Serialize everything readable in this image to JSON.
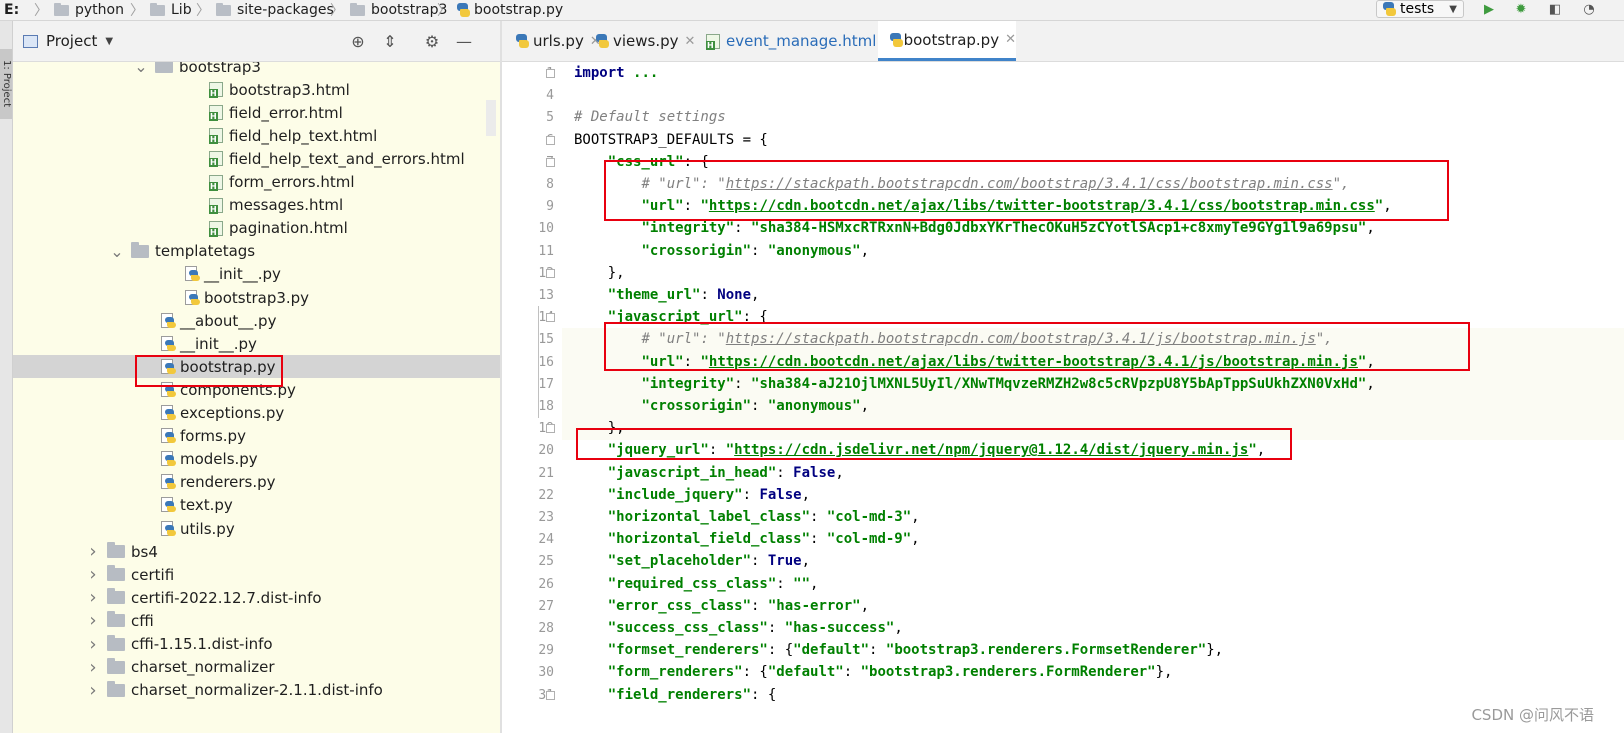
{
  "breadcrumbs": [
    "E:",
    "python",
    "Lib",
    "site-packages",
    "bootstrap3",
    "bootstrap.py"
  ],
  "run_config": "tests",
  "toolbar_icons": [
    "run-icon",
    "debug-icon",
    "coverage-icon",
    "profile-icon"
  ],
  "colors": {
    "accent": "#4083c9",
    "highlight_box": "#e8000f",
    "tree_bg": "#fdfde8",
    "keyword": "#000080",
    "string": "#008000"
  },
  "project_panel": {
    "title": "Project",
    "strip_label": "1: Project",
    "tree": [
      {
        "label": "bootstrap3",
        "kind": "folder",
        "expanded": true
      },
      {
        "label": "bootstrap3.html",
        "kind": "html"
      },
      {
        "label": "field_error.html",
        "kind": "html"
      },
      {
        "label": "field_help_text.html",
        "kind": "html"
      },
      {
        "label": "field_help_text_and_errors.html",
        "kind": "html"
      },
      {
        "label": "form_errors.html",
        "kind": "html"
      },
      {
        "label": "messages.html",
        "kind": "html"
      },
      {
        "label": "pagination.html",
        "kind": "html"
      },
      {
        "label": "templatetags",
        "kind": "folder",
        "expanded": true
      },
      {
        "label": "__init__.py",
        "kind": "py"
      },
      {
        "label": "bootstrap3.py",
        "kind": "py"
      },
      {
        "label": "__about__.py",
        "kind": "py"
      },
      {
        "label": "__init__.py",
        "kind": "py"
      },
      {
        "label": "bootstrap.py",
        "kind": "py",
        "selected": true
      },
      {
        "label": "components.py",
        "kind": "py"
      },
      {
        "label": "exceptions.py",
        "kind": "py"
      },
      {
        "label": "forms.py",
        "kind": "py"
      },
      {
        "label": "models.py",
        "kind": "py"
      },
      {
        "label": "renderers.py",
        "kind": "py"
      },
      {
        "label": "text.py",
        "kind": "py"
      },
      {
        "label": "utils.py",
        "kind": "py"
      },
      {
        "label": "bs4",
        "kind": "folder",
        "expanded": false
      },
      {
        "label": "certifi",
        "kind": "folder",
        "expanded": false
      },
      {
        "label": "certifi-2022.12.7.dist-info",
        "kind": "folder",
        "expanded": false
      },
      {
        "label": "cffi",
        "kind": "folder",
        "expanded": false
      },
      {
        "label": "cffi-1.15.1.dist-info",
        "kind": "folder",
        "expanded": false
      },
      {
        "label": "charset_normalizer",
        "kind": "folder",
        "expanded": false
      },
      {
        "label": "charset_normalizer-2.1.1.dist-info",
        "kind": "folder",
        "expanded": false
      }
    ]
  },
  "editor_tabs": [
    {
      "label": "urls.py",
      "kind": "py"
    },
    {
      "label": "views.py",
      "kind": "py"
    },
    {
      "label": "event_manage.html",
      "kind": "html"
    },
    {
      "label": "bootstrap.py",
      "kind": "py",
      "active": true
    }
  ],
  "code_lines": [
    {
      "n": "1",
      "parts": [
        [
          "k",
          "import"
        ],
        [
          "",
          " "
        ],
        [
          "s",
          "..."
        ]
      ]
    },
    {
      "n": "4",
      "parts": []
    },
    {
      "n": "5",
      "parts": [
        [
          "cm",
          "# Default settings"
        ]
      ]
    },
    {
      "n": "6",
      "parts": [
        [
          "",
          "BOOTSTRAP3_DEFAULTS = {"
        ]
      ]
    },
    {
      "n": "7",
      "parts": [
        [
          "",
          "    "
        ],
        [
          "s",
          "\"css_url\""
        ],
        [
          "",
          ": {"
        ]
      ]
    },
    {
      "n": "8",
      "parts": [
        [
          "",
          "        "
        ],
        [
          "cm",
          "# \"url\": \""
        ],
        [
          "cm u",
          "https://stackpath.bootstrapcdn.com/bootstrap/3.4.1/css/bootstrap.min.css"
        ],
        [
          "cm",
          "\","
        ]
      ]
    },
    {
      "n": "9",
      "parts": [
        [
          "",
          "        "
        ],
        [
          "s",
          "\"url\""
        ],
        [
          "",
          ": "
        ],
        [
          "s",
          "\""
        ],
        [
          "s u",
          "https://cdn.bootcdn.net/ajax/libs/twitter-bootstrap/3.4.1/css/bootstrap.min.css"
        ],
        [
          "s",
          "\""
        ],
        [
          "",
          ","
        ]
      ]
    },
    {
      "n": "10",
      "parts": [
        [
          "",
          "        "
        ],
        [
          "s",
          "\"integrity\""
        ],
        [
          "",
          ": "
        ],
        [
          "s",
          "\"sha384-HSMxcRTRxnN+Bdg0JdbxYKrThecOKuH5zCYotlSAcp1+c8xmyTe9GYg1l9a69psu\""
        ],
        [
          "",
          ","
        ]
      ]
    },
    {
      "n": "11",
      "parts": [
        [
          "",
          "        "
        ],
        [
          "s",
          "\"crossorigin\""
        ],
        [
          "",
          ": "
        ],
        [
          "s",
          "\"anonymous\""
        ],
        [
          "",
          ","
        ]
      ]
    },
    {
      "n": "12",
      "parts": [
        [
          "",
          "    },"
        ]
      ]
    },
    {
      "n": "13",
      "parts": [
        [
          "",
          "    "
        ],
        [
          "s",
          "\"theme_url\""
        ],
        [
          "",
          ": "
        ],
        [
          "k",
          "None"
        ],
        [
          "",
          ","
        ]
      ]
    },
    {
      "n": "14",
      "parts": [
        [
          "",
          "    "
        ],
        [
          "s",
          "\"javascript_url\""
        ],
        [
          "",
          ": {"
        ]
      ]
    },
    {
      "n": "15",
      "parts": [
        [
          "",
          "        "
        ],
        [
          "cm",
          "# \"url\": \""
        ],
        [
          "cm u",
          "https://stackpath.bootstrapcdn.com/bootstrap/3.4.1/js/bootstrap.min.js"
        ],
        [
          "cm",
          "\","
        ]
      ]
    },
    {
      "n": "16",
      "parts": [
        [
          "",
          "        "
        ],
        [
          "s",
          "\"url\""
        ],
        [
          "",
          ": "
        ],
        [
          "s",
          "\""
        ],
        [
          "s u",
          "https://cdn.bootcdn.net/ajax/libs/twitter-bootstrap/3.4.1/js/bootstrap.min.js"
        ],
        [
          "s",
          "\""
        ],
        [
          "",
          ","
        ]
      ]
    },
    {
      "n": "17",
      "parts": [
        [
          "",
          "        "
        ],
        [
          "s",
          "\"integrity\""
        ],
        [
          "",
          ": "
        ],
        [
          "s",
          "\"sha384-aJ21OjlMXNL5UyIl/XNwTMqvzeRMZH2w8c5cRVpzpU8Y5bApTppSuUkhZXN0VxHd\""
        ],
        [
          "",
          ","
        ]
      ]
    },
    {
      "n": "18",
      "parts": [
        [
          "",
          "        "
        ],
        [
          "s",
          "\"crossorigin\""
        ],
        [
          "",
          ": "
        ],
        [
          "s",
          "\"anonymous\""
        ],
        [
          "",
          ","
        ]
      ]
    },
    {
      "n": "19",
      "parts": [
        [
          "",
          "    },"
        ]
      ]
    },
    {
      "n": "20",
      "parts": [
        [
          "",
          "    "
        ],
        [
          "s",
          "\"jquery_url\""
        ],
        [
          "",
          ": "
        ],
        [
          "s",
          "\""
        ],
        [
          "s u",
          "https://cdn.jsdelivr.net/npm/jquery@1.12.4/dist/jquery.min.js"
        ],
        [
          "s",
          "\""
        ],
        [
          "",
          ","
        ]
      ]
    },
    {
      "n": "21",
      "parts": [
        [
          "",
          "    "
        ],
        [
          "s",
          "\"javascript_in_head\""
        ],
        [
          "",
          ": "
        ],
        [
          "k",
          "False"
        ],
        [
          "",
          ","
        ]
      ]
    },
    {
      "n": "22",
      "parts": [
        [
          "",
          "    "
        ],
        [
          "s",
          "\"include_jquery\""
        ],
        [
          "",
          ": "
        ],
        [
          "k",
          "False"
        ],
        [
          "",
          ","
        ]
      ]
    },
    {
      "n": "23",
      "parts": [
        [
          "",
          "    "
        ],
        [
          "s",
          "\"horizontal_label_class\""
        ],
        [
          "",
          ": "
        ],
        [
          "s",
          "\"col-md-3\""
        ],
        [
          "",
          ","
        ]
      ]
    },
    {
      "n": "24",
      "parts": [
        [
          "",
          "    "
        ],
        [
          "s",
          "\"horizontal_field_class\""
        ],
        [
          "",
          ": "
        ],
        [
          "s",
          "\"col-md-9\""
        ],
        [
          "",
          ","
        ]
      ]
    },
    {
      "n": "25",
      "parts": [
        [
          "",
          "    "
        ],
        [
          "s",
          "\"set_placeholder\""
        ],
        [
          "",
          ": "
        ],
        [
          "k",
          "True"
        ],
        [
          "",
          ","
        ]
      ]
    },
    {
      "n": "26",
      "parts": [
        [
          "",
          "    "
        ],
        [
          "s",
          "\"required_css_class\""
        ],
        [
          "",
          ": "
        ],
        [
          "s",
          "\"\""
        ],
        [
          "",
          ","
        ]
      ]
    },
    {
      "n": "27",
      "parts": [
        [
          "",
          "    "
        ],
        [
          "s",
          "\"error_css_class\""
        ],
        [
          "",
          ": "
        ],
        [
          "s",
          "\"has-error\""
        ],
        [
          "",
          ","
        ]
      ]
    },
    {
      "n": "28",
      "parts": [
        [
          "",
          "    "
        ],
        [
          "s",
          "\"success_css_class\""
        ],
        [
          "",
          ": "
        ],
        [
          "s",
          "\"has-success\""
        ],
        [
          "",
          ","
        ]
      ]
    },
    {
      "n": "29",
      "parts": [
        [
          "",
          "    "
        ],
        [
          "s",
          "\"formset_renderers\""
        ],
        [
          "",
          ": {"
        ],
        [
          "s",
          "\"default\""
        ],
        [
          "",
          ": "
        ],
        [
          "s",
          "\"bootstrap3.renderers.FormsetRenderer\""
        ],
        [
          "",
          "},"
        ]
      ]
    },
    {
      "n": "30",
      "parts": [
        [
          "",
          "    "
        ],
        [
          "s",
          "\"form_renderers\""
        ],
        [
          "",
          ": {"
        ],
        [
          "s",
          "\"default\""
        ],
        [
          "",
          ": "
        ],
        [
          "s",
          "\"bootstrap3.renderers.FormRenderer\""
        ],
        [
          "",
          "},"
        ]
      ]
    },
    {
      "n": "31",
      "parts": [
        [
          "",
          "    "
        ],
        [
          "s",
          "\"field_renderers\""
        ],
        [
          "",
          ": {"
        ]
      ]
    }
  ],
  "watermark": "CSDN @问风不语"
}
